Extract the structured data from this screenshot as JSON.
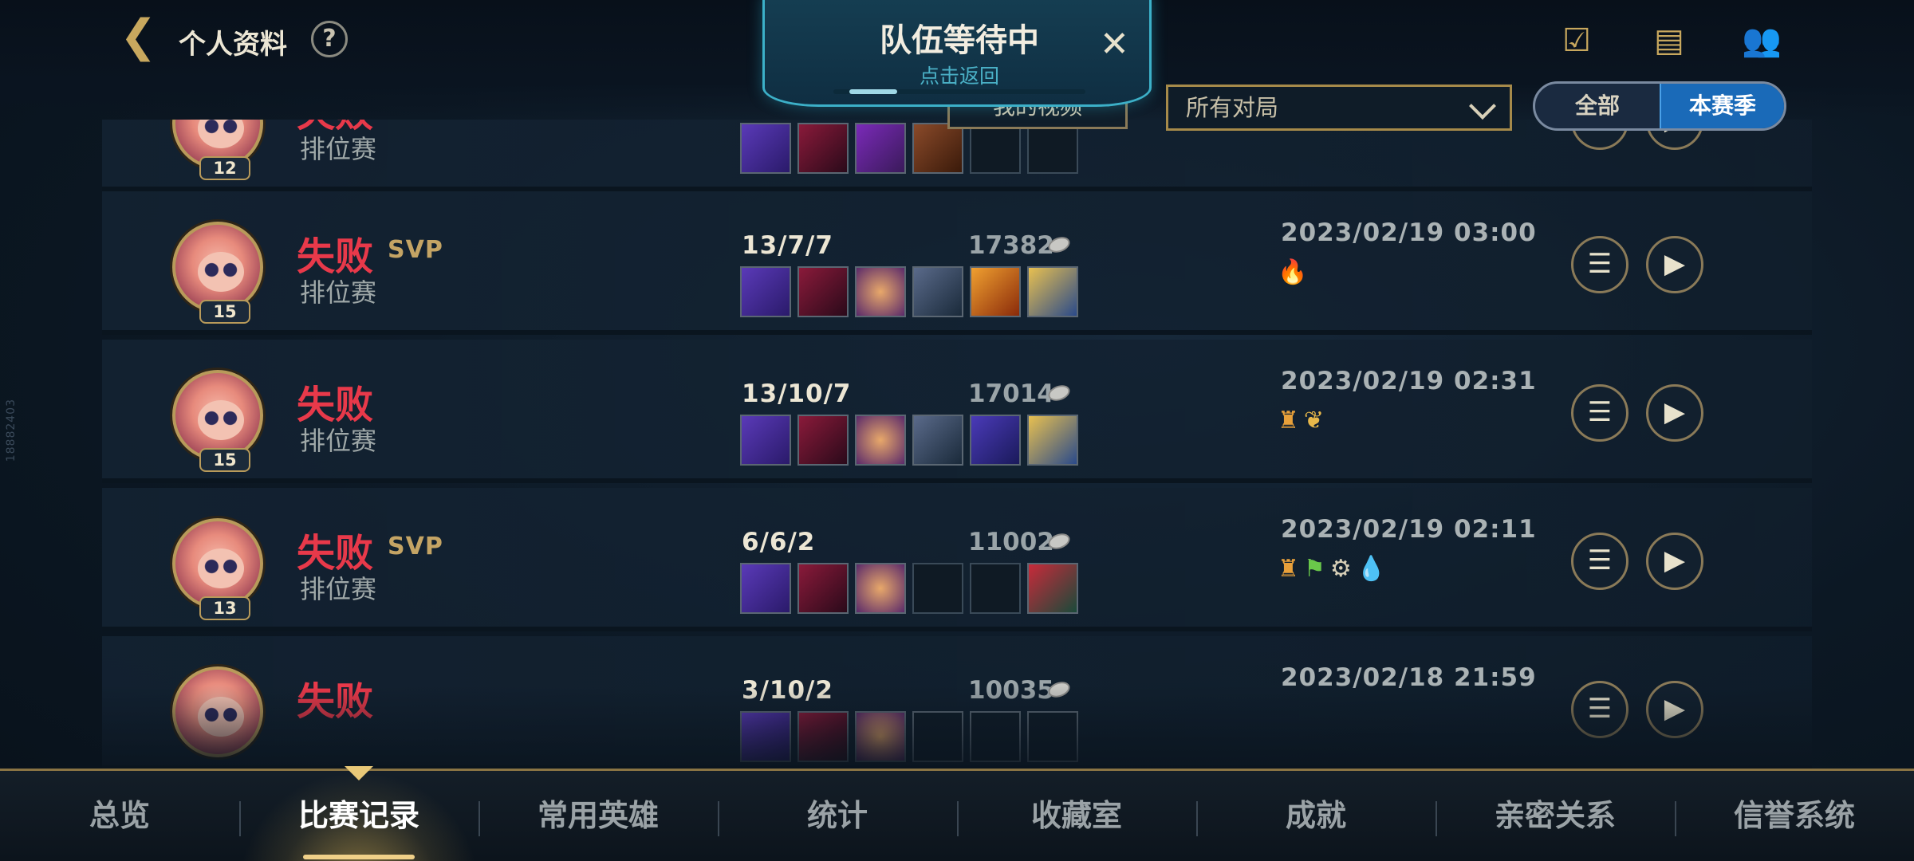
{
  "header": {
    "back_icon": "chevron-left-icon",
    "title": "个人资料",
    "help_label": "?",
    "icons": [
      "task-icon",
      "chat-icon",
      "friends-icon"
    ]
  },
  "banner": {
    "title": "队伍等待中",
    "subtitle": "点击返回",
    "close_label": "✕"
  },
  "filters": {
    "video_label": "我的视频",
    "select_value": "所有对局",
    "season_options": [
      "全部",
      "本赛季"
    ],
    "season_active": "本赛季"
  },
  "side_id": "18882403",
  "matches": [
    {
      "result": "失败",
      "svp": "",
      "mode": "排位赛",
      "level": "12",
      "kda": "",
      "gold": "",
      "date": "",
      "items": [
        "item-1",
        "item-2",
        "item-3",
        "item-4",
        "empty",
        "empty"
      ],
      "badges": []
    },
    {
      "result": "失败",
      "svp": "SVP",
      "mode": "排位赛",
      "level": "15",
      "kda": "13/7/7",
      "gold": "17382",
      "date": "2023/02/19 03:00",
      "items": [
        "item-1",
        "item-2",
        "item-3",
        "item-4",
        "item-5",
        "item-6"
      ],
      "badges": [
        "fire-badge"
      ]
    },
    {
      "result": "失败",
      "svp": "",
      "mode": "排位赛",
      "level": "15",
      "kda": "13/10/7",
      "gold": "17014",
      "date": "2023/02/19 02:31",
      "items": [
        "item-1",
        "item-2",
        "item-3",
        "item-4",
        "item-5",
        "item-6"
      ],
      "badges": [
        "tower-badge",
        "leaf-badge"
      ]
    },
    {
      "result": "失败",
      "svp": "SVP",
      "mode": "排位赛",
      "level": "13",
      "kda": "6/6/2",
      "gold": "11002",
      "date": "2023/02/19 02:11",
      "items": [
        "item-1",
        "item-2",
        "item-3",
        "empty",
        "empty",
        "item-6"
      ],
      "badges": [
        "tower-badge",
        "flag-badge",
        "gear-badge",
        "drop-badge"
      ]
    },
    {
      "result": "失败",
      "svp": "",
      "mode": "",
      "level": "",
      "kda": "3/10/2",
      "gold": "10035",
      "date": "2023/02/18 21:59",
      "items": [
        "item-1",
        "item-2",
        "item-3",
        "item-4",
        "item-5",
        "item-6"
      ],
      "badges": []
    }
  ],
  "nav": {
    "tabs": [
      "总览",
      "比赛记录",
      "常用英雄",
      "统计",
      "收藏室",
      "成就",
      "亲密关系",
      "信誉系统"
    ],
    "active": "比赛记录"
  },
  "colors": {
    "loss": "#e8394a",
    "accent_gold": "#c8a85e",
    "active_blue": "#1a6ab8",
    "banner_cyan": "#3cb0c8"
  }
}
